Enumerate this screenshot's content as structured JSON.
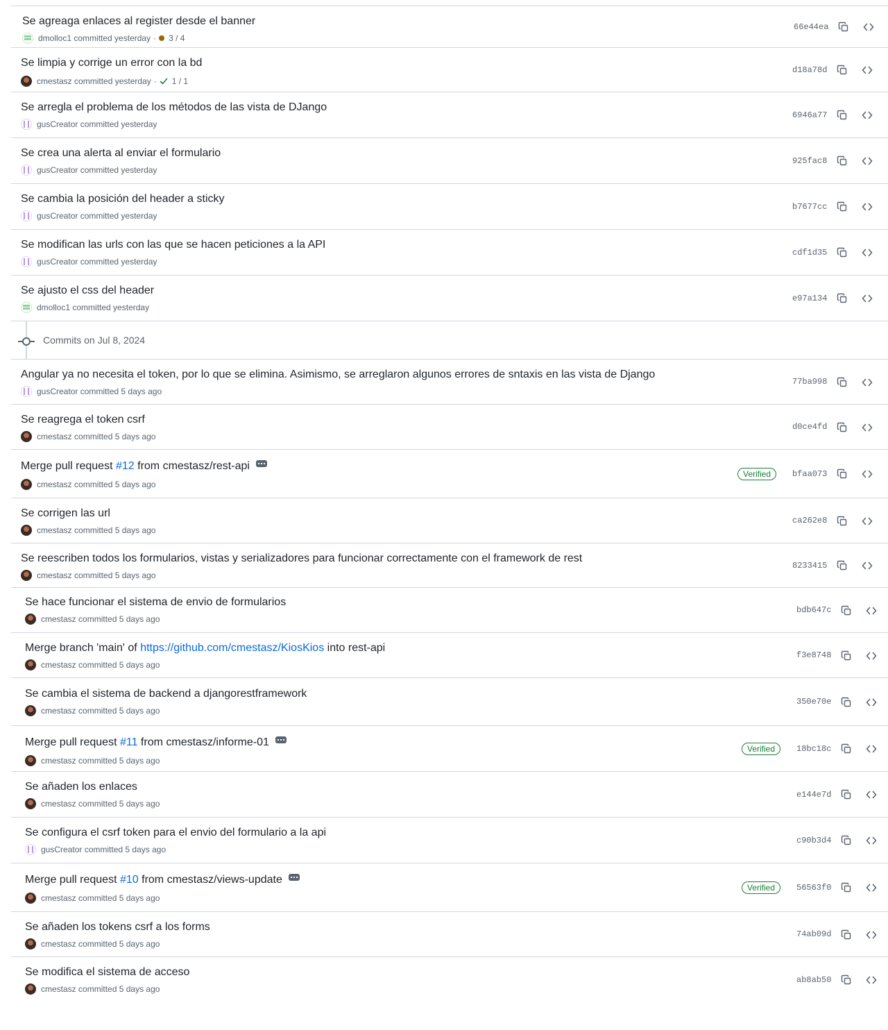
{
  "commits_before": [
    {
      "title": "Se agreaga enlaces al register desde el banner",
      "author": "dmolloc1",
      "avatar": "dm",
      "committed": "committed yesterday",
      "status": "pending",
      "status_text": "3 / 4",
      "sha": "66e44ea"
    },
    {
      "title": "Se limpia y corrige un error con la bd",
      "author": "cmestasz",
      "avatar": "cm",
      "committed": "committed yesterday",
      "status": "success",
      "status_text": "1 / 1",
      "sha": "d18a78d"
    },
    {
      "title": "Se arregla el problema de los métodos de las vista de DJango",
      "author": "gusCreator",
      "avatar": "gus",
      "committed": "committed yesterday",
      "sha": "6946a77"
    },
    {
      "title": "Se crea una alerta al enviar el formulario",
      "author": "gusCreator",
      "avatar": "gus",
      "committed": "committed yesterday",
      "sha": "925fac8"
    },
    {
      "title": "Se cambia la posición del header a sticky",
      "author": "gusCreator",
      "avatar": "gus",
      "committed": "committed yesterday",
      "sha": "b7677cc"
    },
    {
      "title": "Se modifican las urls con las que se hacen peticiones a la API",
      "author": "gusCreator",
      "avatar": "gus",
      "committed": "committed yesterday",
      "sha": "cdf1d35"
    },
    {
      "title": "Se ajusto el css del header",
      "author": "dmolloc1",
      "avatar": "dm",
      "committed": "committed yesterday",
      "sha": "e97a134"
    }
  ],
  "group_header": "Commits on Jul 8, 2024",
  "commits_after": [
    {
      "title": "Angular ya no necesita el token, por lo que se elimina. Asimismo, se arreglaron algunos errores de sntaxis en las vista de Django",
      "author": "gusCreator",
      "avatar": "gus",
      "committed": "committed 5 days ago",
      "sha": "77ba998"
    },
    {
      "title": "Se reagrega el token csrf",
      "author": "cmestasz",
      "avatar": "cm",
      "committed": "committed 5 days ago",
      "sha": "d0ce4fd"
    },
    {
      "title_pre": "Merge pull request ",
      "link": "#12",
      "title_post": " from cmestasz/rest-api",
      "more": true,
      "verified": "Verified",
      "author": "cmestasz",
      "avatar": "cm",
      "committed": "committed 5 days ago",
      "sha": "bfaa073"
    },
    {
      "title": "Se corrigen las url",
      "author": "cmestasz",
      "avatar": "cm",
      "committed": "committed 5 days ago",
      "sha": "ca262e8"
    },
    {
      "title": "Se reescriben todos los formularios, vistas y serializadores para funcionar correctamente con el framework de rest",
      "author": "cmestasz",
      "avatar": "cm",
      "committed": "committed 5 days ago",
      "sha": "8233415"
    },
    {
      "title": "Se hace funcionar el sistema de envio de formularios",
      "author": "cmestasz",
      "avatar": "cm",
      "committed": "committed 5 days ago",
      "sha": "bdb647c"
    },
    {
      "title_pre": "Merge branch 'main' of ",
      "link": "https://github.com/cmestasz/KiosKios",
      "title_post": " into rest-api",
      "author": "cmestasz",
      "avatar": "cm",
      "committed": "committed 5 days ago",
      "sha": "f3e8748"
    },
    {
      "title": "Se cambia el sistema de backend a djangorestframework",
      "author": "cmestasz",
      "avatar": "cm",
      "committed": "committed 5 days ago",
      "sha": "350e70e"
    },
    {
      "title_pre": "Merge pull request ",
      "link": "#11",
      "title_post": " from cmestasz/informe-01",
      "more": true,
      "verified": "Verified",
      "author": "cmestasz",
      "avatar": "cm",
      "committed": "committed 5 days ago",
      "sha": "18bc18c"
    },
    {
      "title": "Se añaden los enlaces",
      "author": "cmestasz",
      "avatar": "cm",
      "committed": "committed 5 days ago",
      "sha": "e144e7d"
    },
    {
      "title": "Se configura el csrf token para el envio del formulario a la api",
      "author": "gusCreator",
      "avatar": "gus",
      "committed": "committed 5 days ago",
      "sha": "c90b3d4"
    },
    {
      "title_pre": "Merge pull request ",
      "link": "#10",
      "title_post": " from cmestasz/views-update",
      "more": true,
      "verified": "Verified",
      "author": "cmestasz",
      "avatar": "cm",
      "committed": "committed 5 days ago",
      "sha": "56563f0"
    },
    {
      "title": "Se añaden los tokens csrf a los forms",
      "author": "cmestasz",
      "avatar": "cm",
      "committed": "committed 5 days ago",
      "sha": "74ab09d"
    },
    {
      "title": "Se modifica el sistema de acceso",
      "author": "cmestasz",
      "avatar": "cm",
      "committed": "committed 5 days ago",
      "sha": "ab8ab50"
    }
  ],
  "icons": {
    "copy": "copy-icon",
    "browse": "code-icon",
    "pending": "dot-icon",
    "success": "check-icon",
    "more": "ellipsis-icon"
  },
  "colors": {
    "link": "#0969da",
    "verified": "#1a7f37",
    "pending": "#9a6700",
    "muted": "#59636e",
    "border": "#d0d7de"
  }
}
